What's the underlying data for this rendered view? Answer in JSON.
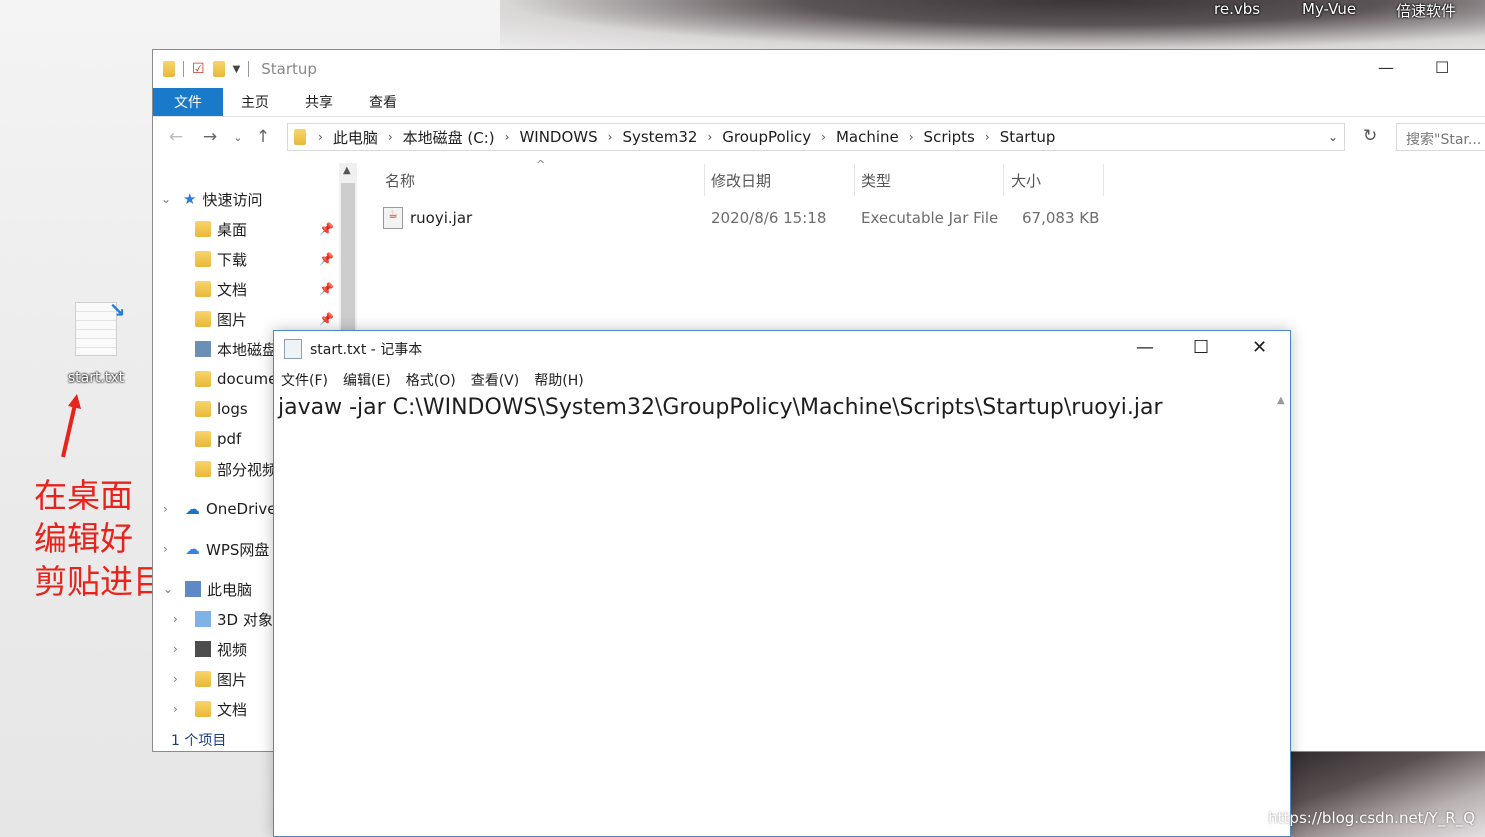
{
  "desktop": {
    "top_icons": [
      "re.vbs",
      "My-Vue",
      "倍速软件"
    ],
    "file_icon_label": "start.txt",
    "annotation_lines": [
      "在桌面",
      "编辑好",
      "剪贴进目录"
    ],
    "watermark": "https://blog.csdn.net/Y_R_Q"
  },
  "explorer": {
    "title": "Startup",
    "tabs": [
      "文件",
      "主页",
      "共享",
      "查看"
    ],
    "breadcrumbs": [
      "此电脑",
      "本地磁盘 (C:)",
      "WINDOWS",
      "System32",
      "GroupPolicy",
      "Machine",
      "Scripts",
      "Startup"
    ],
    "search_placeholder": "搜索\"Star...",
    "nav": {
      "quick_access": "快速访问",
      "items": [
        "桌面",
        "下载",
        "文档",
        "图片",
        "本地磁盘",
        "docume",
        "logs",
        "pdf",
        "部分视频"
      ],
      "onedrive": "OneDrive",
      "wps": "WPS网盘",
      "this_pc": "此电脑",
      "pc_items": [
        "3D 对象",
        "视频",
        "图片",
        "文档"
      ]
    },
    "columns": [
      "名称",
      "修改日期",
      "类型",
      "大小"
    ],
    "files": [
      {
        "name": "ruoyi.jar",
        "date": "2020/8/6 15:18",
        "type": "Executable Jar File",
        "size": "67,083 KB"
      }
    ],
    "status": "1 个项目"
  },
  "notepad": {
    "title": "start.txt - 记事本",
    "menu": [
      "文件(F)",
      "编辑(E)",
      "格式(O)",
      "查看(V)",
      "帮助(H)"
    ],
    "content": "javaw -jar C:\\WINDOWS\\System32\\GroupPolicy\\Machine\\Scripts\\Startup\\ruoyi.jar"
  }
}
